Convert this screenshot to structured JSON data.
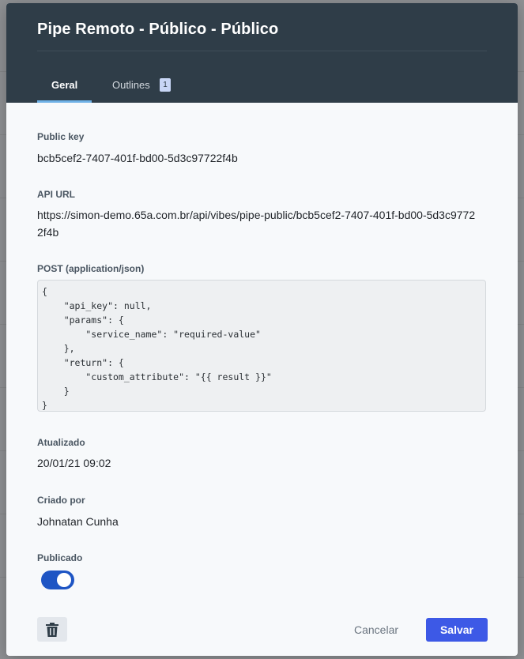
{
  "modal": {
    "title": "Pipe Remoto - Público - Público",
    "tabs": [
      {
        "label": "Geral",
        "active": true
      },
      {
        "label": "Outlines",
        "badge": "1",
        "active": false
      }
    ]
  },
  "fields": {
    "public_key": {
      "label": "Public key",
      "value": "bcb5cef2-7407-401f-bd00-5d3c97722f4b"
    },
    "api_url": {
      "label": "API URL",
      "value": "https://simon-demo.65a.com.br/api/vibes/pipe-public/bcb5cef2-7407-401f-bd00-5d3c97722f4b"
    },
    "post": {
      "label": "POST (application/json)",
      "code": "{\n    \"api_key\": null,\n    \"params\": {\n        \"service_name\": \"required-value\"\n    },\n    \"return\": {\n        \"custom_attribute\": \"{{ result }}\"\n    }\n}"
    },
    "updated": {
      "label": "Atualizado",
      "value": "20/01/21 09:02"
    },
    "created_by": {
      "label": "Criado por",
      "value": "Johnatan Cunha"
    },
    "published": {
      "label": "Publicado",
      "value": true
    }
  },
  "footer": {
    "delete_icon": "trash-icon",
    "cancel_label": "Cancelar",
    "save_label": "Salvar"
  },
  "colors": {
    "header_bg": "#2f3d48",
    "accent": "#3d59e6",
    "toggle_on": "#1e55c4",
    "tab_underline": "#6fb1e6"
  }
}
